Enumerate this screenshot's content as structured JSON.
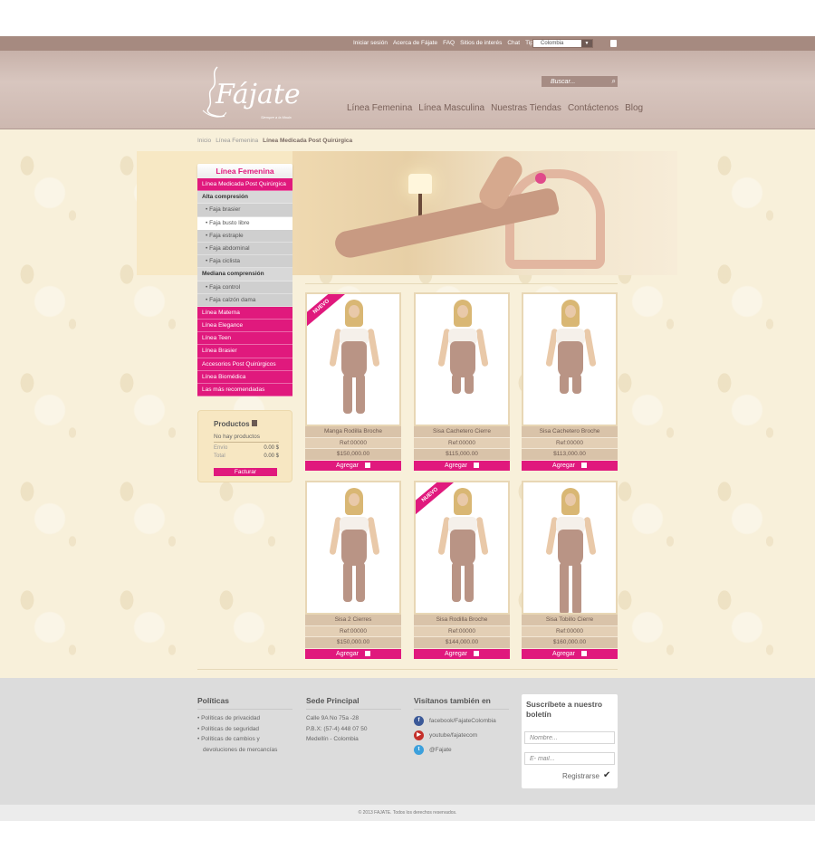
{
  "topbar": {
    "links": [
      "Iniciar sesión",
      "Acerca de Fájate",
      "FAQ",
      "Sitios de interés",
      "Chat",
      "Tips"
    ],
    "country": "Colombia"
  },
  "header": {
    "logo_text": "Fájate",
    "logo_tag": "Siempre a la Moda",
    "search_placeholder": "Buscar...",
    "nav": [
      "Línea Femenina",
      "Línea Masculina",
      "Nuestras Tiendas",
      "Contáctenos",
      "Blog"
    ]
  },
  "breadcrumb": {
    "items": [
      "Inicio",
      "Línea Femenina"
    ],
    "current": "Línea Medicada Post Quirúrgica"
  },
  "sidebar": {
    "title": "Línea Femenina",
    "items": [
      {
        "label": "Línea Medicada Post Quirúrgica",
        "type": "pink"
      },
      {
        "label": "Alta compresión",
        "type": "head"
      },
      {
        "label": "• Faja brasier",
        "type": "sub"
      },
      {
        "label": "• Faja busto libre",
        "type": "sub-active"
      },
      {
        "label": "• Faja estraple",
        "type": "sub"
      },
      {
        "label": "• Faja abdominal",
        "type": "sub"
      },
      {
        "label": "• Faja ciclista",
        "type": "sub"
      },
      {
        "label": "Mediana comprensión",
        "type": "head"
      },
      {
        "label": "• Faja control",
        "type": "sub"
      },
      {
        "label": "• Faja calzón dama",
        "type": "sub"
      },
      {
        "label": "Línea Materna",
        "type": "pink"
      },
      {
        "label": "Línea Elegance",
        "type": "pink"
      },
      {
        "label": "Línea Teen",
        "type": "pink"
      },
      {
        "label": "Línea Brasier",
        "type": "pink"
      },
      {
        "label": "Accesorios Post Quirúrgicos",
        "type": "pink"
      },
      {
        "label": "Línea Biomédica",
        "type": "pink"
      },
      {
        "label": "Las más recomendadas",
        "type": "pink"
      }
    ]
  },
  "cart": {
    "title": "Productos",
    "empty": "No hay productos",
    "envio_label": "Envío",
    "envio_value": "0.00 $",
    "total_label": "Total",
    "total_value": "0.00 $",
    "button": "Facturar"
  },
  "products": [
    {
      "name": "Manga Rodilla Broche",
      "ref": "Ref:00000",
      "price": "$150,000.00",
      "badge": "NUEVO",
      "add": "Agregar"
    },
    {
      "name": "Sisa Cachetero Cierre",
      "ref": "Ref:00000",
      "price": "$115,000.00",
      "badge": "",
      "add": "Agregar"
    },
    {
      "name": "Sisa Cachetero Broche",
      "ref": "Ref:00000",
      "price": "$113,000.00",
      "badge": "",
      "add": "Agregar"
    },
    {
      "name": "Sisa 2 Cierres",
      "ref": "Ref:00000",
      "price": "$150,000.00",
      "badge": "",
      "add": "Agregar"
    },
    {
      "name": "Sisa Rodilla Broche",
      "ref": "Ref:00000",
      "price": "$144,000.00",
      "badge": "NUEVO",
      "add": "Agregar"
    },
    {
      "name": "Sisa Tobillo Cierre",
      "ref": "Ref:00000",
      "price": "$160,000.00",
      "badge": "",
      "add": "Agregar"
    }
  ],
  "footer": {
    "politicas": {
      "title": "Políticas",
      "items": [
        "• Políticas de privacidad",
        "• Políticas de seguridad",
        "• Políticas de cambios y",
        "devoluciones de mercancías"
      ]
    },
    "sede": {
      "title": "Sede Principal",
      "lines": [
        "Calle 9A No 75a -28",
        "P.B.X:  (57-4) 448 07 50",
        "Medellín - Colombia"
      ]
    },
    "social": {
      "title": "Visítanos también en",
      "items": [
        {
          "label": "facebook/FajateColombia",
          "icon": "facebook-icon",
          "color": "#3b5998",
          "glyph": "f"
        },
        {
          "label": "youtube/fajatecom",
          "icon": "youtube-icon",
          "color": "#c4302b",
          "glyph": "▶"
        },
        {
          "label": "@Fajate",
          "icon": "twitter-icon",
          "color": "#3ca0dc",
          "glyph": "t"
        }
      ]
    },
    "newsletter": {
      "title": "Suscríbete a nuestro boletín",
      "name_placeholder": "Nombre...",
      "email_placeholder": "E- mail...",
      "button": "Registrarse"
    },
    "copyright": "© 2013 FAJATE. Todos los derechos reservados."
  },
  "colors": {
    "accent": "#e0197d",
    "brand": "#a68a80"
  }
}
